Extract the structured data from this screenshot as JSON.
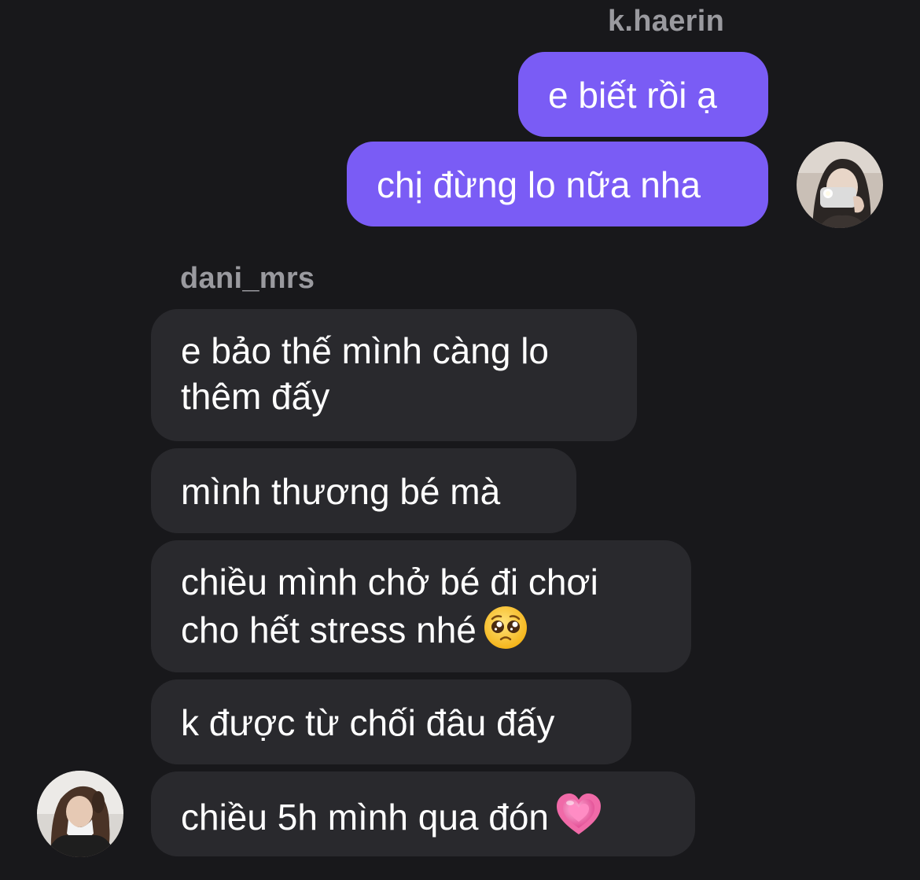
{
  "outgoing": {
    "sender": "k.haerin",
    "messages": [
      "e biết rồi ạ",
      "chị đừng lo nữa nha"
    ]
  },
  "incoming": {
    "sender": "dani_mrs",
    "messages": [
      {
        "lines": [
          "e bảo thế mình càng lo",
          "thêm đấy"
        ]
      },
      {
        "lines": [
          "mình thương bé mà"
        ]
      },
      {
        "lines": [
          "chiều mình chở bé đi chơi",
          "cho hết stress nhé"
        ],
        "emoji": "pleading-face-icon"
      },
      {
        "lines": [
          "k được từ chối đâu đấy"
        ]
      },
      {
        "lines": [
          "chiều 5h mình qua đón"
        ],
        "emoji": "growing-heart-icon"
      }
    ]
  },
  "avatars": {
    "outgoing": "k.haerin-avatar",
    "incoming": "dani_mrs-avatar"
  },
  "colors": {
    "background": "#18181b",
    "outgoing_bubble": "#7a5cf5",
    "incoming_bubble": "#29292d",
    "sender_name": "#9a9a9f"
  }
}
